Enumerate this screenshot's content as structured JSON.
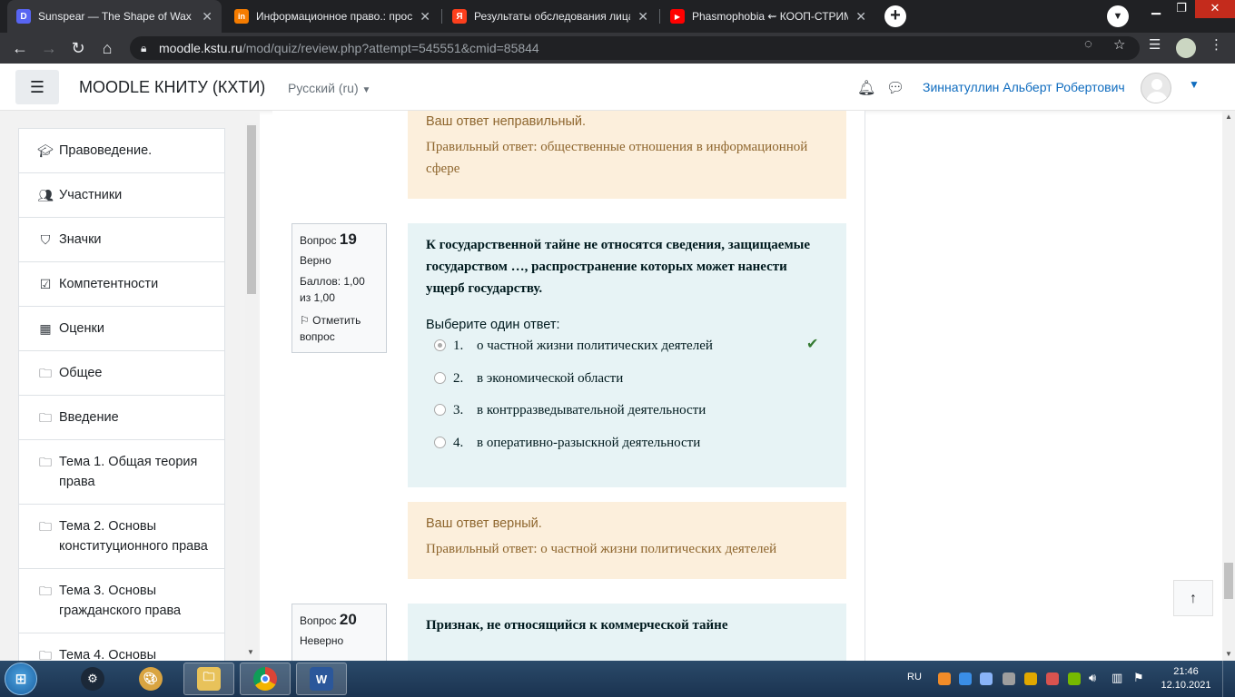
{
  "browser": {
    "tabs": [
      {
        "title": "Sunspear — The Shape of Wax",
        "favicon_color": "#5865f2",
        "favicon_text": "D",
        "active": true
      },
      {
        "title": "Информационное право.: прос",
        "favicon_color": "#f57c00",
        "favicon_text": "in",
        "active": false
      },
      {
        "title": "Результаты обследования лица,",
        "favicon_color": "#fc3f1d",
        "favicon_text": "Я",
        "active": false
      },
      {
        "title": "Phasmophobia ⇜ КООП-СТРИМ",
        "favicon_color": "#ff0000",
        "favicon_text": "▶",
        "active": false
      }
    ],
    "newtab_label": "+",
    "url_host": "moodle.kstu.ru",
    "url_path": "/mod/quiz/review.php?attempt=545551&cmid=85844"
  },
  "navbar": {
    "site_name": "MOODLE КНИТУ (КХТИ)",
    "language": "Русский (ru)",
    "user_name": "Зиннатуллин Альберт Робертович"
  },
  "drawer": {
    "items": [
      {
        "label": "Правоведение.",
        "icon": "graduation-cap-icon"
      },
      {
        "label": "Участники",
        "icon": "users-icon"
      },
      {
        "label": "Значки",
        "icon": "shield-icon"
      },
      {
        "label": "Компетентности",
        "icon": "checkbox-icon"
      },
      {
        "label": "Оценки",
        "icon": "table-icon"
      },
      {
        "label": "Общее",
        "icon": "folder-icon"
      },
      {
        "label": "Введение",
        "icon": "folder-icon"
      },
      {
        "label": "Тема 1. Общая теория права",
        "icon": "folder-icon"
      },
      {
        "label": "Тема 2. Основы конституционного права",
        "icon": "folder-icon"
      },
      {
        "label": "Тема 3. Основы гражданского права",
        "icon": "folder-icon"
      },
      {
        "label": "Тема 4. Основы",
        "icon": "folder-icon"
      }
    ]
  },
  "prev_feedback": {
    "status": "Ваш ответ неправильный.",
    "correct_answer": "Правильный ответ: общественные отношения в информационной сфере"
  },
  "q19": {
    "label": "Вопрос",
    "number": "19",
    "state": "Верно",
    "grade": "Баллов: 1,00 из 1,00",
    "flag": "Отметить вопрос",
    "stem": "К государственной тайне не относятся сведения, защищаемые государством …, распространение которых может нанести ущерб государству.",
    "prompt": "Выберите один ответ:",
    "answers": [
      {
        "num": "1.",
        "text": "о частной жизни политических деятелей",
        "checked": true,
        "correct": true
      },
      {
        "num": "2.",
        "text": "в экономической области",
        "checked": false,
        "correct": false
      },
      {
        "num": "3.",
        "text": "в контрразведывательной деятельности",
        "checked": false,
        "correct": false
      },
      {
        "num": "4.",
        "text": "в оперативно-разыскной деятельности",
        "checked": false,
        "correct": false
      }
    ],
    "feedback_status": "Ваш ответ верный.",
    "feedback_correct": "Правильный ответ: о частной жизни политических деятелей"
  },
  "q20": {
    "label": "Вопрос",
    "number": "20",
    "state": "Неверно",
    "stem": "Признак, не относящийся к коммерческой тайне"
  },
  "taskbar": {
    "lang": "RU",
    "time": "21:46",
    "date": "12.10.2021"
  },
  "colors": {
    "feedback_bg": "#fcefdc",
    "question_bg": "#e7f3f5",
    "link": "#0f6cbf",
    "correct_tick": "#357a32"
  }
}
